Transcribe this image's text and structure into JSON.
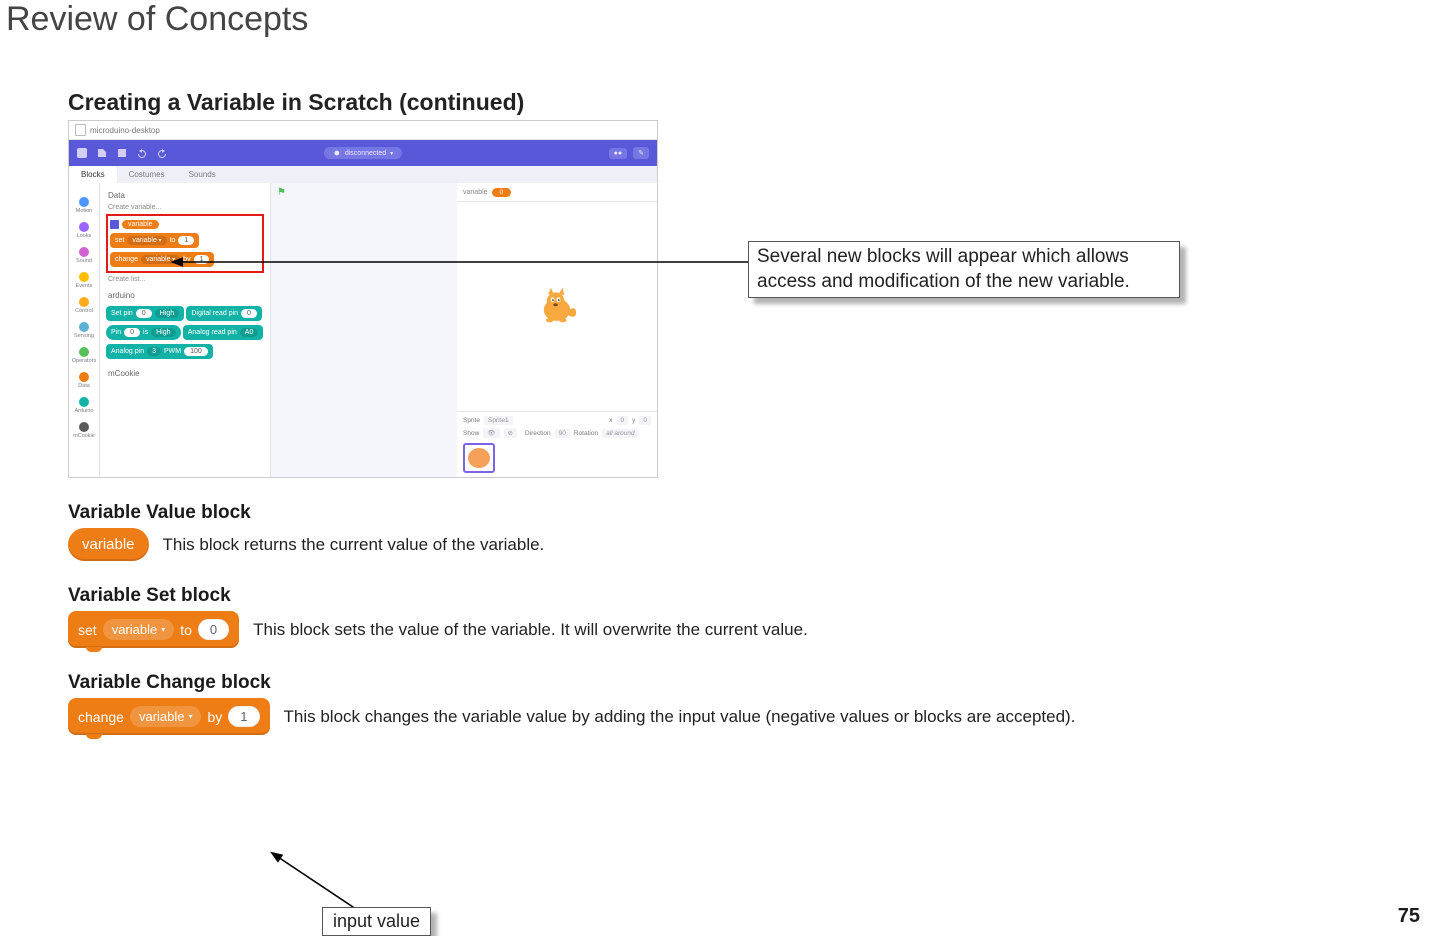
{
  "page": {
    "title": "Review of Concepts",
    "number": "75"
  },
  "section": {
    "heading": "Creating a Variable in Scratch (continued)"
  },
  "callouts": {
    "newBlocks": "Several new blocks will appear which allows access and modification of the new variable.",
    "inputValue": "input value"
  },
  "screenshot": {
    "windowTitle": "microduino-desktop",
    "connection": "disconnected",
    "tabs": {
      "blocks": "Blocks",
      "costumes": "Costumes",
      "sounds": "Sounds"
    },
    "categories": [
      {
        "name": "Motion",
        "color": "#4c97ff"
      },
      {
        "name": "Looks",
        "color": "#9966ff"
      },
      {
        "name": "Sound",
        "color": "#cf63cf"
      },
      {
        "name": "Events",
        "color": "#ffbf00"
      },
      {
        "name": "Control",
        "color": "#ffab19"
      },
      {
        "name": "Sensing",
        "color": "#5cb1d6"
      },
      {
        "name": "Operators",
        "color": "#59c059"
      },
      {
        "name": "Data",
        "color": "#ee7d16"
      },
      {
        "name": "Arduino",
        "color": "#12b3a6"
      },
      {
        "name": "mCookie",
        "color": "#5a5a5a"
      }
    ],
    "palette": {
      "headerData": "Data",
      "createVariable": "Create variable...",
      "variableChip": "variable",
      "set": {
        "label_set": "set",
        "var": "variable",
        "label_to": "to",
        "value": "1"
      },
      "change": {
        "label_change": "change",
        "var": "variable",
        "label_by": "by",
        "value": "1"
      },
      "createList": "Create list...",
      "headerArduino": "arduino",
      "arduinoBlocks": {
        "setPin": {
          "a": "Set pin",
          "b": "0",
          "c": "High"
        },
        "digitalRead": {
          "a": "Digital read pin",
          "b": "0"
        },
        "pinIs": {
          "a": "Pin",
          "b": "0",
          "c": "is",
          "d": "High"
        },
        "analogRead": {
          "a": "Analog read pin",
          "b": "A0"
        },
        "analogPwm": {
          "a": "Analog pin",
          "b": "3",
          "c": "PWM",
          "d": "100"
        }
      },
      "headerMCookie": "mCookie"
    },
    "stage": {
      "variableLabel": "variable",
      "variableValue": "0",
      "spriteLabelKey": "Sprite",
      "spriteName": "Sprite1",
      "x": "x",
      "xv": "0",
      "y": "y",
      "yv": "0",
      "showLabel": "Show",
      "directionLabel": "Direction",
      "direction": "90",
      "rotationLabel": "Rotation",
      "rotation": "all around"
    }
  },
  "blocks": {
    "value": {
      "heading": "Variable Value block",
      "label": "variable",
      "desc": "This block returns the current value of the variable."
    },
    "set": {
      "heading": "Variable Set block",
      "label_set": "set",
      "var": "variable",
      "label_to": "to",
      "value": "0",
      "desc": "This block sets the value of the variable. It will overwrite the current value."
    },
    "change": {
      "heading": "Variable Change block",
      "label_change": "change",
      "var": "variable",
      "label_by": "by",
      "value": "1",
      "desc": "This block changes the variable value by adding the input value (negative values or blocks are accepted)."
    }
  }
}
